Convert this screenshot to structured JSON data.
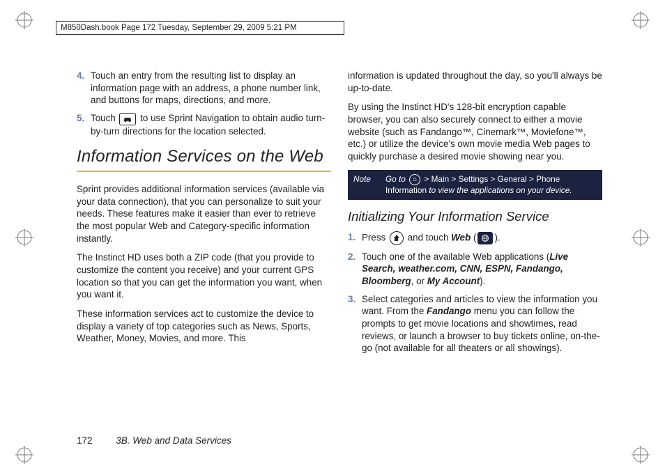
{
  "header": {
    "text": "M850Dash.book  Page 172  Tuesday, September 29, 2009  5:21 PM"
  },
  "left": {
    "step4": "Touch an entry from the resulting list to display an information page with an address, a phone number link, and buttons for maps, directions, and more.",
    "step5_a": "Touch ",
    "step5_b": " to use Sprint Navigation to obtain audio turn-by-turn directions for the location selected.",
    "section_title": "Information Services on the Web",
    "p1": "Sprint provides additional information services (available via your data connection), that you can personalize to suit your needs. These features make it easier than ever to retrieve the most popular Web and Category-specific information instantly.",
    "p2": "The Instinct HD uses both a ZIP code (that you provide to customize the content you receive) and your current GPS location so that you can get the information you want, when you want it.",
    "p3": "These information services act to customize the device to display a variety of top categories such as News, Sports, Weather, Money, Movies, and more. This"
  },
  "right": {
    "p1": "information is updated throughout the day, so you'll always be up-to-date.",
    "p2": "By using the Instinct HD's 128-bit encryption capable browser, you can also securely connect to either a movie website (such as Fandango™, Cinemark™, Moviefone™, etc.) or utilize the device's own movie media Web pages to quickly purchase a desired movie showing near you.",
    "note_label": "Note",
    "note_a": "Go to ",
    "note_path": " > Main > Settings > General > Phone Information",
    "note_b": " to view the applications on your device.",
    "subsection": "Initializing Your Information Service",
    "s1_a": "Press ",
    "s1_b": " and touch ",
    "s1_web": "Web",
    "s1_c": " (",
    "s1_d": ").",
    "s2_a": "Touch one of the available Web applications (",
    "s2_apps": "Live Search, weather.com, CNN, ESPN, Fandango, Bloomberg",
    "s2_b": ", or ",
    "s2_my": "My Account",
    "s2_c": ").",
    "s3_a": "Select categories and articles to view the information you want. From the ",
    "s3_f": "Fandango",
    "s3_b": " menu you can follow the prompts to get movie locations and showtimes, read reviews, or launch a browser to buy tickets online, on-the-go (not available for all theaters or all showings)."
  },
  "footer": {
    "page": "172",
    "section": "3B. Web and Data Services"
  },
  "nums": {
    "n4": "4.",
    "n5": "5.",
    "n1": "1.",
    "n2": "2.",
    "n3": "3."
  }
}
